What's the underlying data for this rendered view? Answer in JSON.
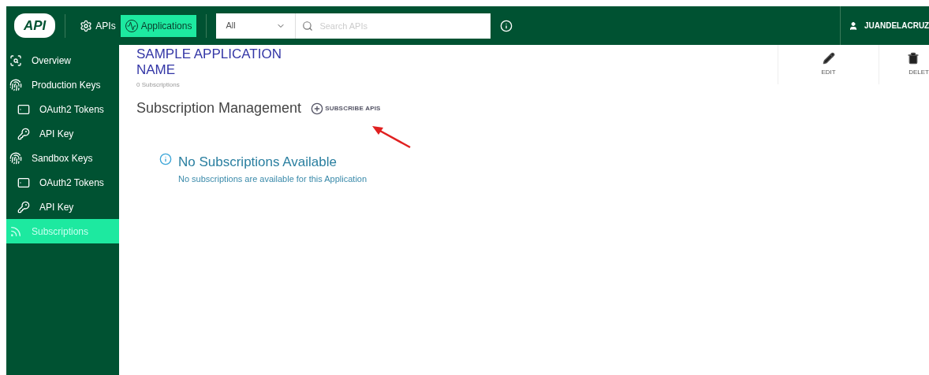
{
  "topbar": {
    "logo": "API",
    "nav": [
      {
        "label": "APIs",
        "kind": "gear",
        "selected": false
      },
      {
        "label": "Applications",
        "kind": "apps",
        "selected": true
      }
    ],
    "filter": {
      "value": "All"
    },
    "search": {
      "placeholder": "Search APIs"
    },
    "user": "JUANDELACRUZ"
  },
  "sidebar": {
    "items": [
      {
        "label": "Overview",
        "kind": "overview",
        "selected": false
      },
      {
        "label": "Production Keys",
        "kind": "keys",
        "selected": false,
        "children": [
          {
            "label": "OAuth2 Tokens",
            "kind": "tokens",
            "selected": false
          },
          {
            "label": "API Key",
            "kind": "key",
            "selected": false
          }
        ]
      },
      {
        "label": "Sandbox Keys",
        "kind": "keys",
        "selected": false,
        "children": [
          {
            "label": "OAuth2 Tokens",
            "kind": "tokens",
            "selected": false
          },
          {
            "label": "API Key",
            "kind": "key",
            "selected": false
          }
        ]
      },
      {
        "label": "Subscriptions",
        "kind": "subscriptions",
        "selected": true
      }
    ]
  },
  "header": {
    "title": "SAMPLE APPLICATION NAME",
    "subtitle": "0 Subscriptions",
    "actions": [
      {
        "label": "EDIT",
        "kind": "edit"
      },
      {
        "label": "DELET",
        "kind": "delete"
      }
    ]
  },
  "section": {
    "title": "Subscription Management",
    "action": "SUBSCRIBE APIS"
  },
  "empty": {
    "title": "No Subscriptions Available",
    "message": "No subscriptions are available for this Application"
  }
}
